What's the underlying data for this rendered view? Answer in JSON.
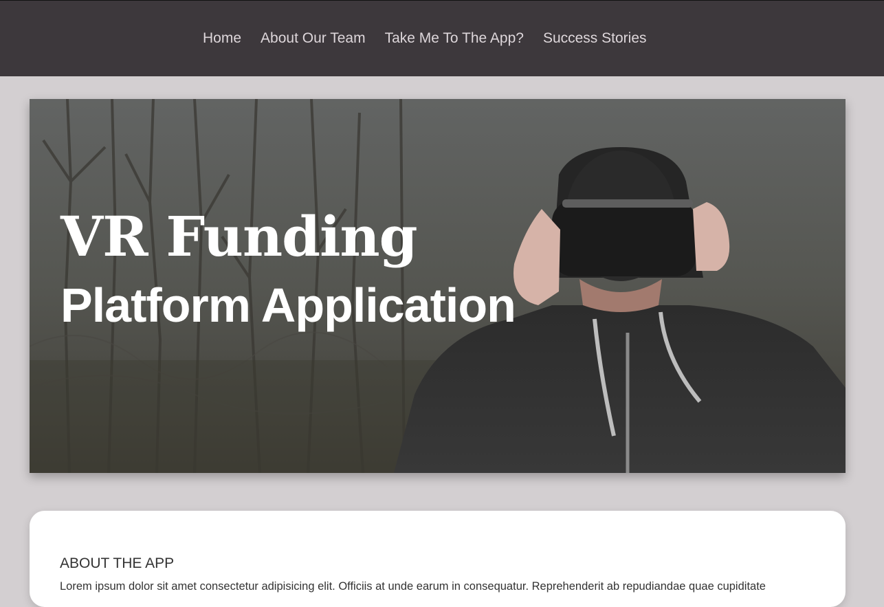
{
  "nav": {
    "items": [
      {
        "label": "Home"
      },
      {
        "label": "About Our Team"
      },
      {
        "label": "Take Me To The App?"
      },
      {
        "label": "Success Stories"
      }
    ]
  },
  "hero": {
    "title": "VR Funding",
    "subtitle": "Platform Application"
  },
  "about": {
    "heading": "ABOUT THE APP",
    "text": "Lorem ipsum dolor sit amet consectetur adipisicing elit. Officiis at unde earum in consequatur. Reprehenderit ab repudiandae quae cupiditate"
  },
  "colors": {
    "navbar": "#3d383c",
    "page_background": "#d3cfd1",
    "nav_text": "#ded7db"
  }
}
